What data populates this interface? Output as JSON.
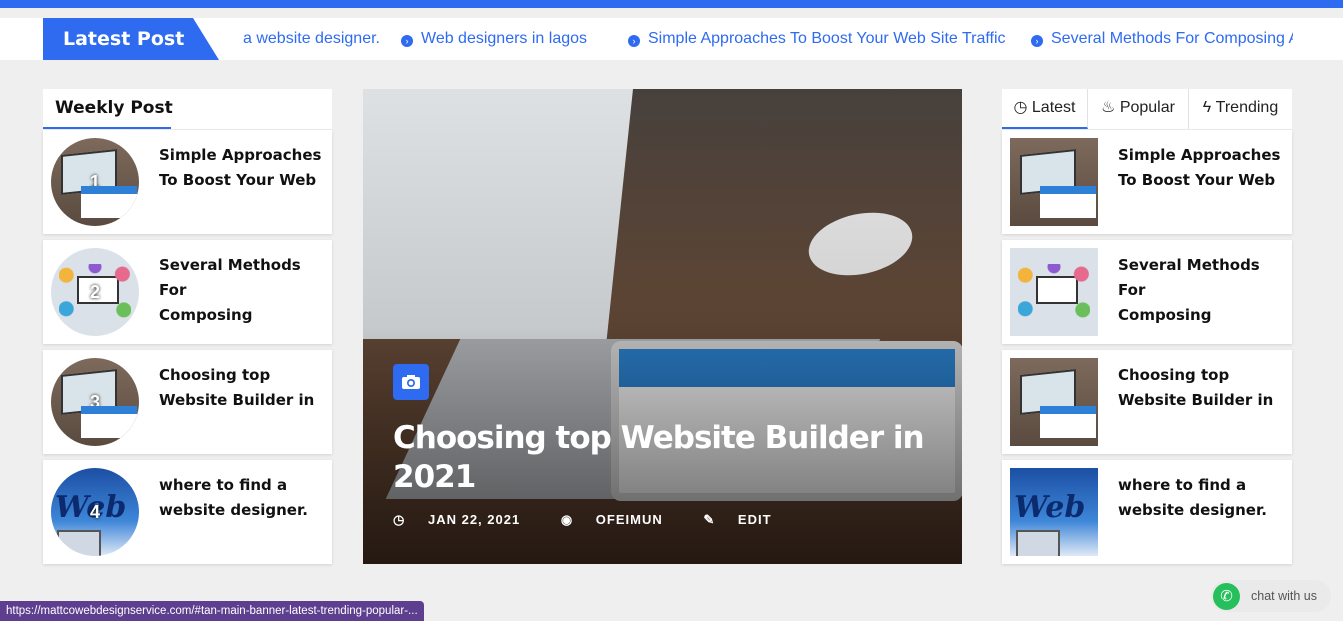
{
  "ticker": {
    "label": "Latest Post",
    "items": [
      "a website designer.",
      "Web designers in lagos",
      "Simple Approaches To Boost Your Web Site Traffic",
      "Several Methods For Composing A"
    ]
  },
  "weekly": {
    "title": "Weekly Post",
    "posts": [
      {
        "num": "1",
        "line1": "Simple Approaches",
        "line2": "To Boost Your Web",
        "image": "laptop"
      },
      {
        "num": "2",
        "line1": "Several Methods For",
        "line2": "Composing",
        "image": "marketing"
      },
      {
        "num": "3",
        "line1": "Choosing top",
        "line2": "Website Builder in",
        "image": "laptop"
      },
      {
        "num": "4",
        "line1": "where to find a",
        "line2": "website designer.",
        "image": "web"
      }
    ]
  },
  "hero": {
    "category_icon": "camera-icon",
    "title": "Choosing top Website Builder in 2021",
    "date": "JAN 22, 2021",
    "author": "OFEIMUN",
    "edit_label": "EDIT"
  },
  "tabs": {
    "items": [
      {
        "label": "Latest",
        "icon": "clock-icon"
      },
      {
        "label": "Popular",
        "icon": "fire-icon"
      },
      {
        "label": "Trending",
        "icon": "bolt-icon"
      }
    ],
    "active": "Latest"
  },
  "side_posts": [
    {
      "line1": "Simple Approaches",
      "line2": "To Boost Your Web",
      "image": "laptop"
    },
    {
      "line1": "Several Methods For",
      "line2": "Composing",
      "image": "marketing"
    },
    {
      "line1": "Choosing top",
      "line2": "Website Builder in",
      "image": "laptop"
    },
    {
      "line1": "where to find a",
      "line2": "website designer.",
      "image": "web"
    }
  ],
  "status_url": "https://mattcowebdesignservice.com/#tan-main-banner-latest-trending-popular-...",
  "chat_label": "chat with us",
  "colors": {
    "accent": "#2e6bf0",
    "status": "#5d3e8f",
    "whatsapp": "#25c05b"
  }
}
